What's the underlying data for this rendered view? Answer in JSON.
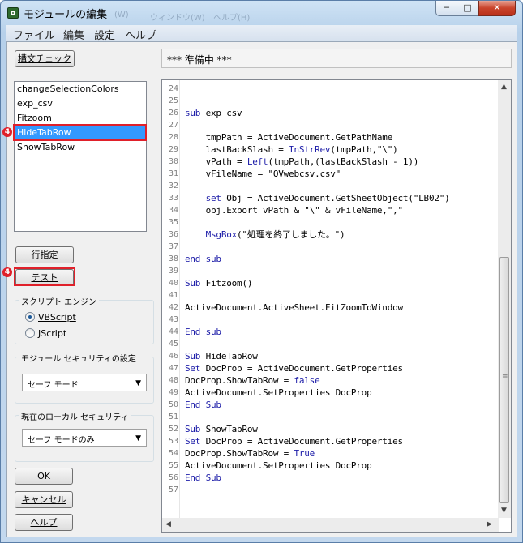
{
  "window": {
    "title": "モジュールの編集",
    "ghost_menu": [
      "(W)",
      "ウィンドウ(W)",
      "ヘルプ(H)"
    ],
    "caption": {
      "minimize": "─",
      "maximize": "□",
      "close": "✕"
    }
  },
  "menu": [
    "ファイル",
    "編集",
    "設定",
    "ヘルプ"
  ],
  "toolbar": {
    "syntax_check": "構文チェック"
  },
  "status": "*** 準備中 ***",
  "modules": [
    "changeSelectionColors",
    "exp_csv",
    "Fitzoom",
    "HideTabRow",
    "ShowTabRow"
  ],
  "markers": {
    "m1": "4",
    "m2": "4"
  },
  "buttons": {
    "line_spec": "行指定",
    "test": "テスト",
    "ok": "OK",
    "cancel": "キャンセル",
    "help": "ヘルプ"
  },
  "script_engine": {
    "title": "スクリプト エンジン",
    "vbscript": "VBScript",
    "jscript": "JScript"
  },
  "module_security": {
    "title": "モジュール セキュリティの設定",
    "value": "セーフ モード"
  },
  "local_security": {
    "title": "現在のローカル セキュリティ",
    "value": "セーフ モードのみ"
  },
  "code": {
    "line_numbers": [
      "24",
      "25",
      "26",
      "27",
      "28",
      "29",
      "30",
      "31",
      "32",
      "33",
      "34",
      "35",
      "36",
      "37",
      "38",
      "39",
      "40",
      "41",
      "42",
      "43",
      "44",
      "45",
      "46",
      "47",
      "48",
      "49",
      "50",
      "51",
      "52",
      "53",
      "54",
      "55",
      "56",
      "57"
    ],
    "lines": [
      "",
      "",
      "sub exp_csv",
      "",
      "    tmpPath = ActiveDocument.GetPathName",
      "    lastBackSlash = InStrRev(tmpPath,\"\\\")",
      "    vPath = Left(tmpPath,(lastBackSlash - 1))",
      "    vFileName = \"QVwebcsv.csv\"",
      "",
      "    set Obj = ActiveDocument.GetSheetObject(\"LB02\")",
      "    obj.Export vPath & \"\\\" & vFileName,\",\"",
      "",
      "    MsgBox(\"処理を終了しました。\")",
      "",
      "end sub",
      "",
      "Sub Fitzoom()",
      "",
      "ActiveDocument.ActiveSheet.FitZoomToWindow",
      "",
      "End sub",
      "",
      "Sub HideTabRow",
      "Set DocProp = ActiveDocument.GetProperties",
      "DocProp.ShowTabRow = false",
      "ActiveDocument.SetProperties DocProp",
      "End Sub",
      "",
      "Sub ShowTabRow",
      "Set DocProp = ActiveDocument.GetProperties",
      "DocProp.ShowTabRow = True",
      "ActiveDocument.SetProperties DocProp",
      "End Sub",
      ""
    ]
  },
  "colors": {
    "keyword": "#1c1ca8",
    "selection": "#3399ff",
    "highlight": "#e0202a"
  }
}
